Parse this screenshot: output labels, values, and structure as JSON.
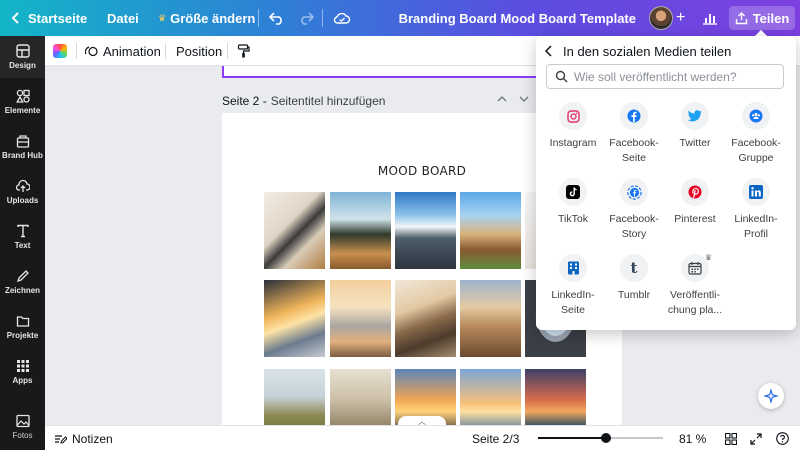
{
  "topbar": {
    "home_label": "Startseite",
    "file_label": "Datei",
    "resize_label": "Größe ändern",
    "title": "Branding Board Mood Board Template",
    "share_label": "Teilen"
  },
  "sidebar": {
    "items": [
      {
        "label": "Design",
        "icon": "design-icon"
      },
      {
        "label": "Elemente",
        "icon": "elements-icon"
      },
      {
        "label": "Brand Hub",
        "icon": "brand-hub-icon"
      },
      {
        "label": "Uploads",
        "icon": "upload-icon"
      },
      {
        "label": "Text",
        "icon": "text-icon"
      },
      {
        "label": "Zeichnen",
        "icon": "draw-icon"
      },
      {
        "label": "Projekte",
        "icon": "folder-icon"
      },
      {
        "label": "Apps",
        "icon": "apps-icon"
      },
      {
        "label": "Fotos",
        "icon": "photos-icon"
      }
    ]
  },
  "toolbar": {
    "animation_label": "Animation",
    "position_label": "Position"
  },
  "canvas": {
    "page_label": "Seite 2 -",
    "page_title_placeholder": "Seitentitel hinzufügen",
    "board_title": "MOOD BOARD"
  },
  "share_panel": {
    "title": "In den sozialen Medien teilen",
    "search_placeholder": "Wie soll veröffentlicht werden?",
    "options": [
      {
        "label": "Instagram",
        "icon": "instagram-icon",
        "color": "#e1306c"
      },
      {
        "label": "Facebook-Seite",
        "icon": "facebook-icon",
        "color": "#1877f2"
      },
      {
        "label": "Twitter",
        "icon": "twitter-icon",
        "color": "#1da1f2"
      },
      {
        "label": "Facebook-Gruppe",
        "icon": "facebook-group-icon",
        "color": "#1877f2"
      },
      {
        "label": "TikTok",
        "icon": "tiktok-icon",
        "color": "#000000"
      },
      {
        "label": "Facebook-Story",
        "icon": "facebook-story-icon",
        "color": "#1877f2"
      },
      {
        "label": "Pinterest",
        "icon": "pinterest-icon",
        "color": "#e60023"
      },
      {
        "label": "LinkedIn-Profil",
        "icon": "linkedin-icon",
        "color": "#0a66c2"
      },
      {
        "label": "LinkedIn-Seite",
        "icon": "linkedin-page-icon",
        "color": "#0a66c2"
      },
      {
        "label": "Tumblr",
        "icon": "tumblr-icon",
        "color": "#35465c"
      },
      {
        "label": "Veröffentli-chung pla...",
        "icon": "schedule-calendar-icon",
        "color": "#3b3f44"
      }
    ]
  },
  "bottombar": {
    "notes_label": "Notizen",
    "page_counter": "Seite 2/3",
    "zoom_label": "81 %",
    "zoom_fraction": 0.54
  },
  "colors": {
    "accent": "#8b3dff",
    "sidebar_bg": "#18191b"
  }
}
